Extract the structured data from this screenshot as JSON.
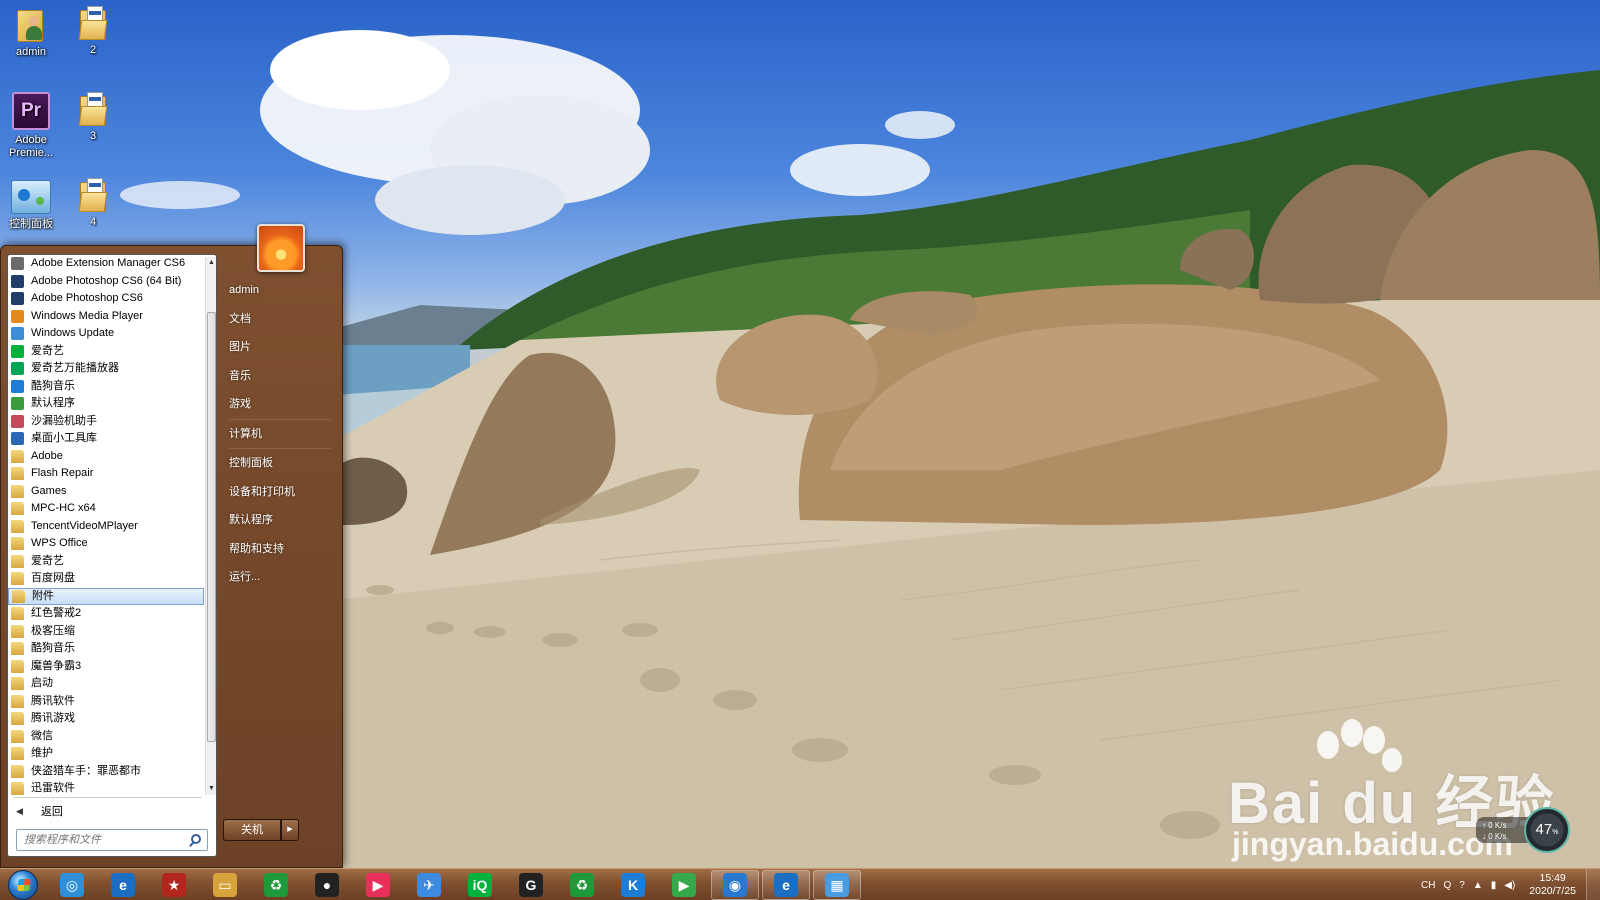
{
  "desktop": {
    "icons": [
      {
        "label": "admin"
      },
      {
        "label": "2"
      },
      {
        "label": "Adobe Premie..."
      },
      {
        "label": "3"
      },
      {
        "label": "控制面板"
      },
      {
        "label": "4"
      }
    ],
    "watermark": {
      "brand": "Bai du 经验",
      "url": "jingyan.baidu.com"
    }
  },
  "start_menu": {
    "programs": [
      {
        "label": "Adobe Extension Manager CS6",
        "icon": "adobe-extension-icon",
        "color": "#6b6b6b"
      },
      {
        "label": "Adobe Photoshop CS6 (64 Bit)",
        "icon": "photoshop-icon",
        "color": "#1e3d6b"
      },
      {
        "label": "Adobe Photoshop CS6",
        "icon": "photoshop-icon",
        "color": "#1e3d6b"
      },
      {
        "label": "Windows Media Player",
        "icon": "media-player-icon",
        "color": "#e38a1f"
      },
      {
        "label": "Windows Update",
        "icon": "windows-update-icon",
        "color": "#3a8fd6"
      },
      {
        "label": "爱奇艺",
        "icon": "iqiyi-icon",
        "color": "#00b13b"
      },
      {
        "label": "爱奇艺万能播放器",
        "icon": "iqiyi-player-icon",
        "color": "#00a653"
      },
      {
        "label": "酷狗音乐",
        "icon": "kugou-icon",
        "color": "#1d7cd6"
      },
      {
        "label": "默认程序",
        "icon": "default-programs-icon",
        "color": "#3b9a3b"
      },
      {
        "label": "沙漏验机助手",
        "icon": "hourglass-icon",
        "color": "#c44a5a"
      },
      {
        "label": "桌面小工具库",
        "icon": "gadgets-icon",
        "color": "#2a67b5"
      },
      {
        "label": "Adobe",
        "icon": "folder-icon",
        "folder": true
      },
      {
        "label": "Flash Repair",
        "icon": "folder-icon",
        "folder": true
      },
      {
        "label": "Games",
        "icon": "folder-icon",
        "folder": true
      },
      {
        "label": "MPC-HC x64",
        "icon": "folder-icon",
        "folder": true
      },
      {
        "label": "TencentVideoMPlayer",
        "icon": "folder-icon",
        "folder": true
      },
      {
        "label": "WPS Office",
        "icon": "folder-icon",
        "folder": true
      },
      {
        "label": "爱奇艺",
        "icon": "folder-icon",
        "folder": true
      },
      {
        "label": "百度网盘",
        "icon": "folder-icon",
        "folder": true
      },
      {
        "label": "附件",
        "icon": "folder-icon",
        "folder": true,
        "selected": true
      },
      {
        "label": "红色警戒2",
        "icon": "folder-icon",
        "folder": true
      },
      {
        "label": "极客压缩",
        "icon": "folder-icon",
        "folder": true
      },
      {
        "label": "酷狗音乐",
        "icon": "folder-icon",
        "folder": true
      },
      {
        "label": "魔兽争霸3",
        "icon": "folder-icon",
        "folder": true
      },
      {
        "label": "启动",
        "icon": "folder-icon",
        "folder": true
      },
      {
        "label": "腾讯软件",
        "icon": "folder-icon",
        "folder": true
      },
      {
        "label": "腾讯游戏",
        "icon": "folder-icon",
        "folder": true
      },
      {
        "label": "微信",
        "icon": "folder-icon",
        "folder": true
      },
      {
        "label": "维护",
        "icon": "folder-icon",
        "folder": true
      },
      {
        "label": "侠盗猎车手：罪恶都市",
        "icon": "folder-icon",
        "folder": true
      },
      {
        "label": "迅雷软件",
        "icon": "folder-icon",
        "folder": true
      }
    ],
    "back_label": "返回",
    "search_placeholder": "搜索程序和文件",
    "right_links": [
      {
        "label": "admin"
      },
      {
        "label": "文档"
      },
      {
        "label": "图片"
      },
      {
        "label": "音乐"
      },
      {
        "label": "游戏"
      },
      {
        "label": "计算机"
      },
      {
        "label": "控制面板"
      },
      {
        "label": "设备和打印机"
      },
      {
        "label": "默认程序"
      },
      {
        "label": "帮助和支持"
      },
      {
        "label": "运行..."
      }
    ],
    "shutdown_label": "关机"
  },
  "taskbar": {
    "pinned": [
      {
        "name": "taskbar-browser-360-icon",
        "color": "#2f8fd8",
        "glyph": "◎"
      },
      {
        "name": "taskbar-ie-icon",
        "color": "#1b6ec2",
        "glyph": "e"
      },
      {
        "name": "taskbar-red-alert-icon",
        "color": "#b3261e",
        "glyph": "★"
      },
      {
        "name": "taskbar-explorer-icon",
        "color": "#d7a43c",
        "glyph": "▭"
      },
      {
        "name": "taskbar-recycle-icon",
        "color": "#1f9a3a",
        "glyph": "♻"
      },
      {
        "name": "taskbar-qq-icon",
        "color": "#222222",
        "glyph": "●"
      },
      {
        "name": "taskbar-youku-icon",
        "color": "#e8305b",
        "glyph": "▶"
      },
      {
        "name": "taskbar-feishu-icon",
        "color": "#3d8be0",
        "glyph": "✈"
      },
      {
        "name": "taskbar-iqiyi-icon",
        "color": "#00b13b",
        "glyph": "iQ"
      },
      {
        "name": "taskbar-g-app-icon",
        "color": "#222222",
        "glyph": "G"
      },
      {
        "name": "taskbar-green-app-icon",
        "color": "#1f9a3a",
        "glyph": "♻"
      },
      {
        "name": "taskbar-kugou-icon",
        "color": "#1d7cd6",
        "glyph": "K"
      },
      {
        "name": "taskbar-player-icon",
        "color": "#35a94a",
        "glyph": "▶"
      },
      {
        "name": "taskbar-search-icon",
        "color": "#2a79d0",
        "glyph": "◉"
      },
      {
        "name": "taskbar-ie-active-icon",
        "color": "#1b6ec2",
        "glyph": "e"
      },
      {
        "name": "taskbar-control-panel-icon",
        "color": "#4a9be0",
        "glyph": "▦"
      }
    ],
    "tray": {
      "lang": "CH",
      "time": "15:49",
      "date": "2020/7/25"
    }
  },
  "net_widget": {
    "up": "0",
    "up_unit": "K/s",
    "down": "0",
    "down_unit": "K/s",
    "percent": "47",
    "percent_unit": "%"
  }
}
